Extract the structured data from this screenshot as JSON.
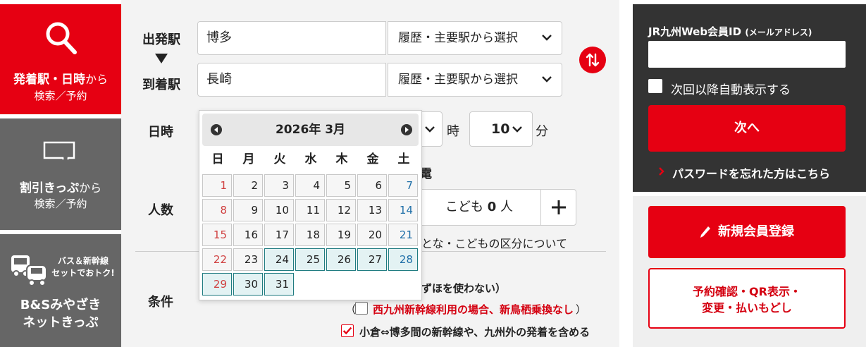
{
  "nav": {
    "search": {
      "bold": "発着駅・日時",
      "small": "から",
      "line2": "検索／予約"
    },
    "discount": {
      "bold": "割引きっぷ",
      "small": "から",
      "line2": "検索／予約"
    },
    "bs": {
      "promo_line1": "バス＆新幹線",
      "promo_line2": "セットでおトク!",
      "title_line1": "B&Sみやざき",
      "title_line2": "ネットきっぷ"
    }
  },
  "form": {
    "departure_label": "出発駅",
    "arrival_label": "到着駅",
    "departure_value": "博多",
    "arrival_value": "長崎",
    "history_select": "履歴・主要駅から選択",
    "date_label": "日時",
    "minute_value": "10",
    "hour_unit": "時",
    "minute_unit": "分",
    "partial_den": "電",
    "people_label": "人数",
    "child_label": "こども",
    "child_count": "0",
    "child_unit": "人",
    "partial_adult_note": "とな・こどもの区分について",
    "conditions_label": "条件",
    "partial_mizuho": "ずほを使わない）",
    "cond_nishikyushu_open": "（",
    "cond_nishikyushu": "西九州新幹線利用の場合、新鳥栖乗換なし",
    "cond_nishikyushu_close": "）",
    "cond_kokura": "小倉⇔博多間の新幹線や、九州外の発着を含める"
  },
  "calendar": {
    "title": "2026年 3月",
    "weekdays": [
      "日",
      "月",
      "火",
      "水",
      "木",
      "金",
      "土"
    ],
    "days": [
      "1",
      "2",
      "3",
      "4",
      "5",
      "6",
      "7",
      "8",
      "9",
      "10",
      "11",
      "12",
      "13",
      "14",
      "15",
      "16",
      "17",
      "18",
      "19",
      "20",
      "21",
      "22",
      "23",
      "24",
      "25",
      "26",
      "27",
      "28",
      "29",
      "30",
      "31"
    ],
    "selected_from": 24
  },
  "login": {
    "id_label": "JR九州Web会員ID",
    "id_label_small": "(メールアドレス)",
    "auto_show_label": "次回以降自動表示する",
    "next_button": "次へ",
    "forgot_link": "パスワードを忘れた方はこちら"
  },
  "actions": {
    "register_button": "新規会員登録",
    "confirm_line1": "予約確認・QR表示・",
    "confirm_line2": "変更・払いもどし"
  },
  "colors": {
    "accent": "#e60012",
    "dark": "#333333",
    "nav_gray": "#666666",
    "selected_day": "#e3f2f3"
  }
}
